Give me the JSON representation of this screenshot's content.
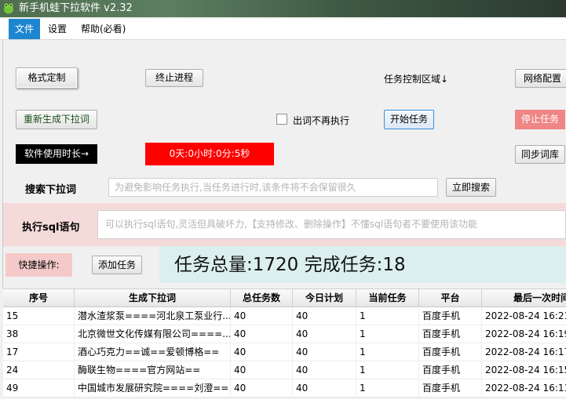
{
  "window": {
    "title": "新手机蛙下拉软件  v2.32"
  },
  "menu": {
    "file": "文件",
    "settings": "设置",
    "help": "帮助(必看)"
  },
  "controls": {
    "format_custom": "格式定制",
    "stop_process": "终止进程",
    "task_area_label": "任务控制区域↓",
    "network_config": "网络配置",
    "regenerate": "重新生成下拉词",
    "no_repeat_checkbox": "出词不再执行",
    "start_task": "开始任务",
    "stop_task": "停止任务",
    "usage_time_label": "软件使用时长→",
    "usage_time_value": "0天:0小时:0分:5秒",
    "sync_dict": "同步词库",
    "search_label": "搜索下拉词",
    "search_placeholder": "为避免影响任务执行,当任务进行时,该条件将不会保留很久",
    "search_now": "立即搜索",
    "sql_label": "执行sql语句",
    "sql_placeholder": "可以执行sql语句,灵活但具破坏力,【支持修改、删除操作】不懂sql语句者不要使用该功能",
    "quick_ops_label": "快捷操作:",
    "add_task": "添加任务",
    "summary": "任务总量:1720  完成任务:18"
  },
  "colors": {
    "accent": "#1e86d0",
    "timer_bg": "#ff0000",
    "stop_btn": "#f08585",
    "sql_band": "#f5dada",
    "summary_band": "#dcefef"
  },
  "table": {
    "columns": [
      "序号",
      "生成下拉词",
      "总任务数",
      "今日计划",
      "当前任务",
      "平台",
      "最后一次时间"
    ],
    "rows": [
      [
        "15",
        "潜水渣浆泵====河北泉工泵业行...",
        "40",
        "40",
        "1",
        "百度手机",
        "2022-08-24 16:21:"
      ],
      [
        "38",
        "北京微世文化传媒有限公司====...",
        "40",
        "40",
        "1",
        "百度手机",
        "2022-08-24 16:19:"
      ],
      [
        "17",
        "酒心巧克力==诚==爱顿博格==",
        "40",
        "40",
        "1",
        "百度手机",
        "2022-08-24 16:17:"
      ],
      [
        "24",
        "酶联生物====官方网站==",
        "40",
        "40",
        "1",
        "百度手机",
        "2022-08-24 16:15:"
      ],
      [
        "49",
        "中国城市发展研究院====刘澄==",
        "40",
        "40",
        "1",
        "百度手机",
        "2022-08-24 16:11:"
      ]
    ]
  }
}
